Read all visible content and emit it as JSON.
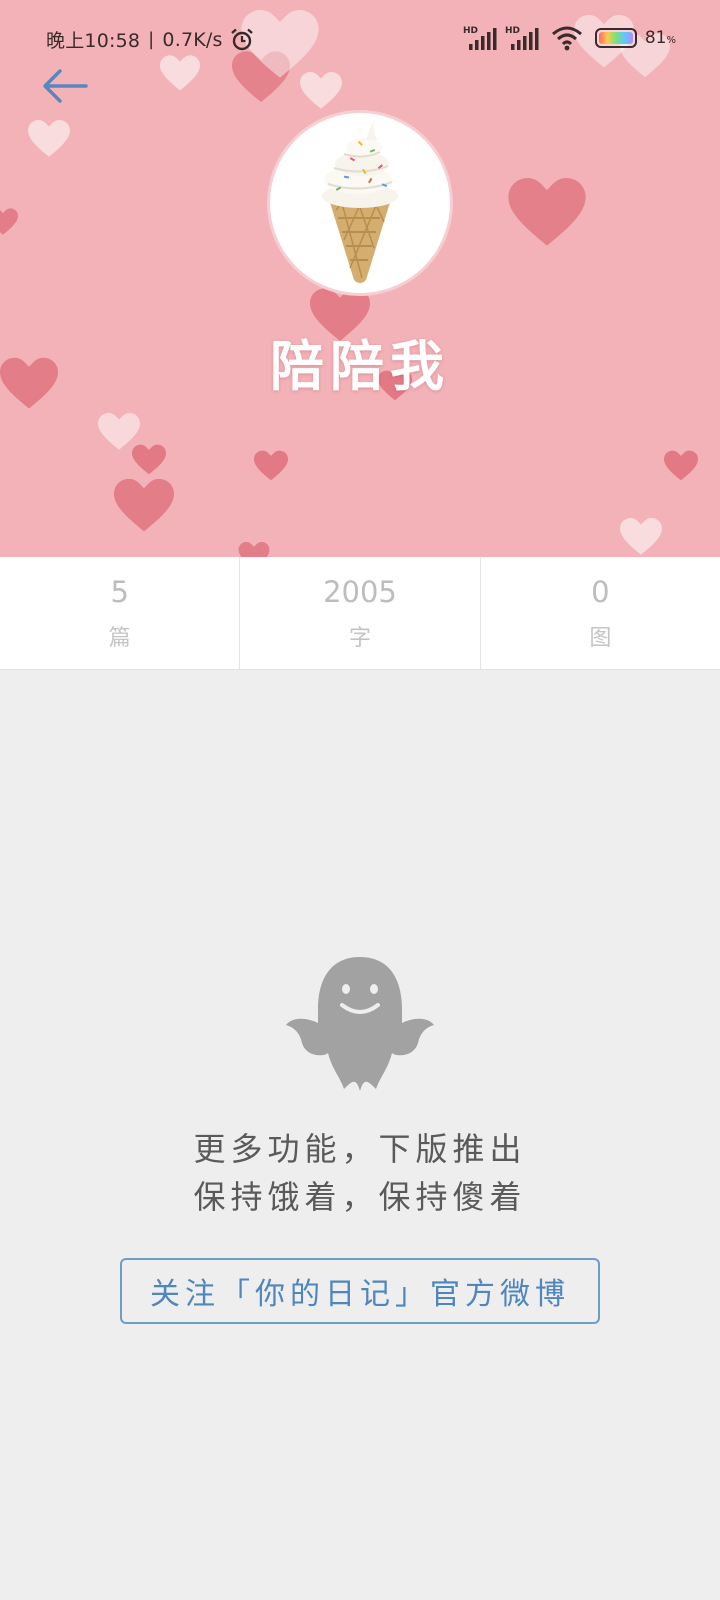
{
  "status_bar": {
    "time": "晚上10:58",
    "separator": "|",
    "network_speed": "0.7K/s",
    "battery_percent": "81",
    "battery_unit": "%"
  },
  "header": {
    "username": "陪陪我",
    "colors": {
      "background": "#f2b2b7",
      "heart": "#e0707c",
      "heart_light": "#ffffff"
    }
  },
  "stats": {
    "articles": {
      "value": "5",
      "label": "篇"
    },
    "words": {
      "value": "2005",
      "label": "字"
    },
    "images": {
      "value": "0",
      "label": "图"
    }
  },
  "empty_state": {
    "icon": "ghost-icon",
    "line1": "更多功能，下版推出",
    "line2": "保持饿着，保持傻着"
  },
  "follow_button": {
    "label": "关注「你的日记」官方微博",
    "color": "#4f86bd"
  },
  "icons": {
    "back": "back-arrow-icon",
    "avatar": "ice-cream-avatar",
    "alarm": "alarm-icon",
    "signal": "signal-icon",
    "wifi": "wifi-icon",
    "battery": "battery-icon"
  }
}
